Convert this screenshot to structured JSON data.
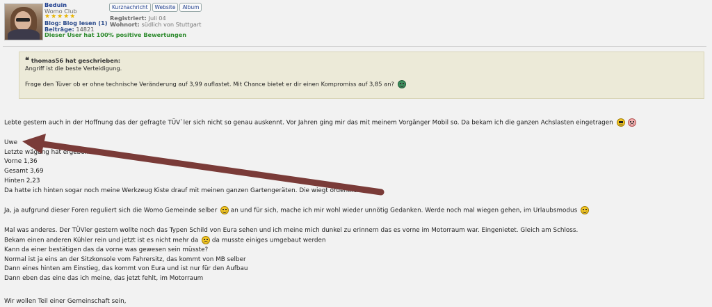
{
  "user": {
    "name": "Beduin",
    "rank": "Womo Club",
    "stars": "★★★★★",
    "blog_label": "Blog:",
    "blog_value": "Blog lesen (1)",
    "posts_label": "Beiträge:",
    "posts_value": "14821",
    "positive": "Dieser User hat 100% positive Bewertungen",
    "registered_label": "Registriert:",
    "registered_value": "Juli 04",
    "residence_label": "Wohnort:",
    "residence_value": "südlich von Stuttgart"
  },
  "buttons": {
    "pm": "Kurznachricht",
    "website": "Website",
    "album": "Album"
  },
  "quote": {
    "mark": "❝",
    "author": "thomas56 hat geschrieben:",
    "line1": "Angriff ist die beste Verteidigung.",
    "line2": "Frage den Tüver ob er ohne technische Veränderung auf 3,99 auflastet. Mit Chance bietet er dir einen Kompromiss auf 3,85 an?"
  },
  "post": {
    "p1": "Lebte gestern auch in der Hoffnung das der gefragte TÜV`ler sich nicht so genau auskennt. Vor Jahren ging mir das mit meinem Vorgänger Mobil so. Da bekam ich die ganzen Achslasten eingetragen",
    "l1": "Uwe",
    "l2": "Letzte wägung hat ergeben",
    "l3": "Vorne 1,36",
    "l4": "Gesamt 3,69",
    "l5": "Hinten 2,23",
    "l6": "Da hatte ich hinten sogar noch meine Werkzeug Kiste drauf mit meinen ganzen Gartengeräten. Die wiegt ordentlich",
    "p2a": "Ja, ja aufgrund dieser Foren reguliert sich die Womo Gemeinde selber",
    "p2b": "an und für sich, mache ich mir wohl wieder unnötig Gedanken. Werde noch mal wiegen gehen, im Urlaubsmodus",
    "p3": "Mal was anderes. Der TÜVler gestern wollte noch das Typen Schild von Eura sehen und ich meine mich dunkel zu erinnern das es vorne im Motorraum war. Eingenietet. Gleich am Schloss.",
    "p4a": "Bekam einen anderen Kühler rein und jetzt ist es nicht mehr da",
    "p4b": "da musste einiges umgebaut werden",
    "p5": "Kann da einer bestätigen das da vorne was gewesen sein müsste?",
    "p6": "Normal ist ja eins an der Sitzkonsole vom Fahrersitz, das kommt von MB selber",
    "p7": "Dann eines hinten am Einstieg, das kommt von Eura und ist nur für den Aufbau",
    "p8": "Dann eben das eine das ich meine, das jetzt fehlt, im Motorraum",
    "sig": "Wir wollen Teil einer Gemeinschaft sein,"
  },
  "icons": {
    "avatar": "user-avatar-photo",
    "arrow_color": "#7a3b38"
  }
}
